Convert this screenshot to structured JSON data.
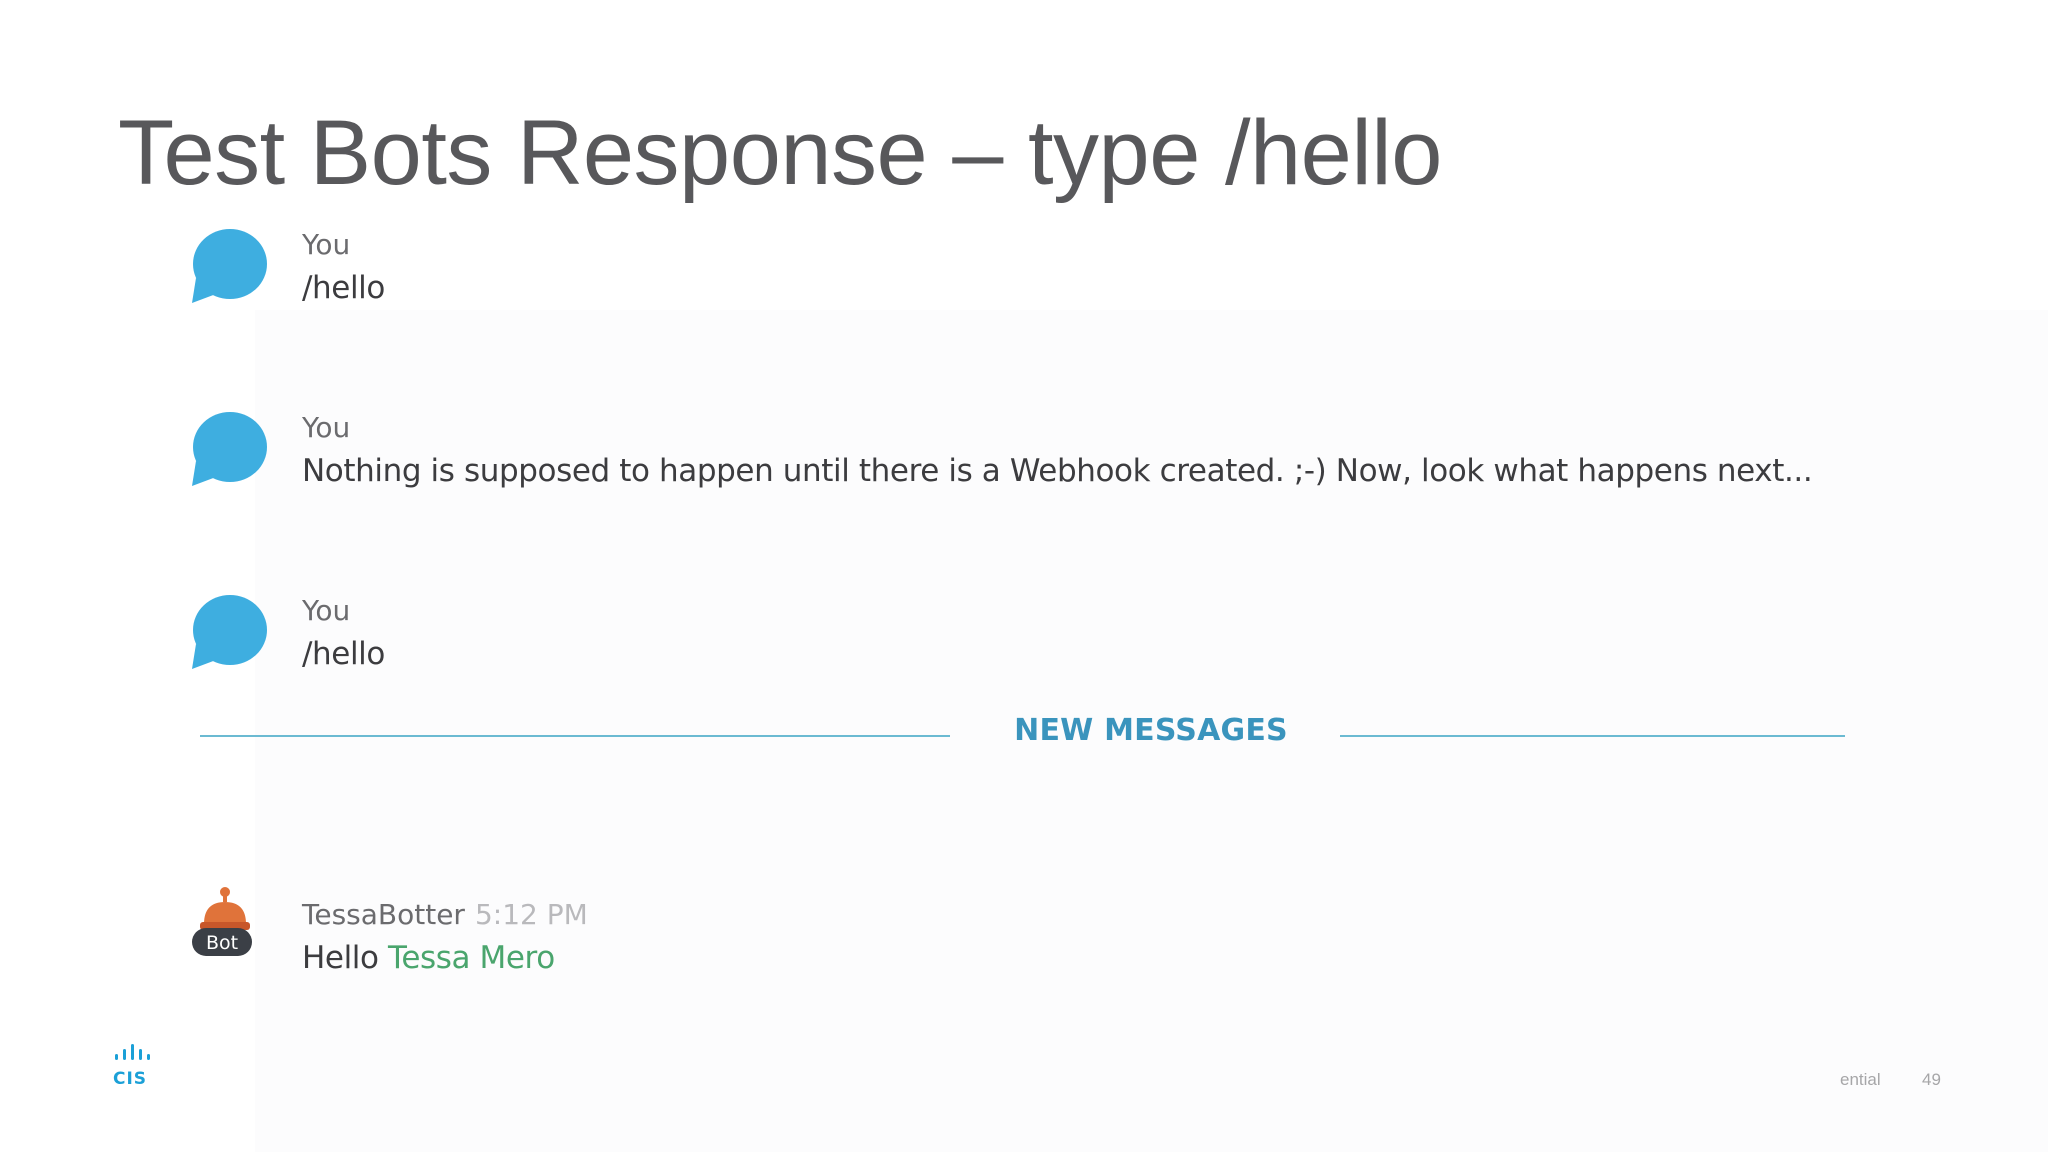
{
  "slide": {
    "title": "Test Bots Response – type /hello",
    "footer_confidential": "ential",
    "page_number": "49",
    "logo_text": "CIS"
  },
  "messages": [
    {
      "sender": "You",
      "text": "/hello",
      "avatar_icon": "speech-bubble-icon"
    },
    {
      "sender": "You",
      "text": "Nothing is supposed to happen until there is a Webhook created. ;-) Now, look what happens next...",
      "avatar_icon": "speech-bubble-icon"
    },
    {
      "sender": "You",
      "text": "/hello",
      "avatar_icon": "speech-bubble-icon"
    }
  ],
  "divider": {
    "label": "NEW MESSAGES"
  },
  "bot_message": {
    "sender": "TessaBotter",
    "time": "5:12 PM",
    "greeting": "Hello",
    "mention": "Tessa Mero",
    "badge": "Bot",
    "avatar_icon": "bot-avatar-icon"
  },
  "colors": {
    "bubble": "#3eaee0",
    "divider": "#6bbad2",
    "divider_label": "#3a94bd",
    "mention": "#4aa56d",
    "title": "#58585b"
  }
}
